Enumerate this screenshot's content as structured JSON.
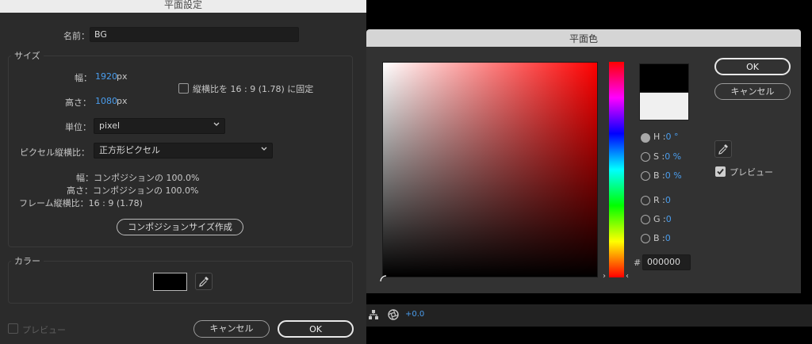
{
  "solid_settings": {
    "title": "平面設定",
    "name_label": "名前：",
    "name_value": "BG",
    "size_group_label": "サイズ",
    "width_label": "幅：",
    "width_value": "1920",
    "width_unit": "px",
    "height_label": "高さ：",
    "height_value": "1080",
    "height_unit": "px",
    "lock_aspect_label": "縦横比を 16 : 9 (1.78) に固定",
    "unit_label": "単位：",
    "unit_value": "pixel",
    "pixel_aspect_label": "ピクセル縦横比：",
    "pixel_aspect_value": "正方形ピクセル",
    "info_width": "幅：コンポジションの 100.0%",
    "info_height": "高さ：コンポジションの 100.0%",
    "info_frame": "フレーム縦横比：16 : 9 (1.78)",
    "make_comp_size_button": "コンポジションサイズ作成",
    "color_group_label": "カラー",
    "swatch_color": "#000000",
    "preview_label": "プレビュー",
    "cancel_button": "キャンセル",
    "ok_button": "OK"
  },
  "color_picker": {
    "title": "平面色",
    "ok_button": "OK",
    "cancel_button": "キャンセル",
    "new_color": "#000000",
    "old_color": "#f0f0f0",
    "h_label": "H :",
    "h_value": "0 °",
    "s_label": "S :",
    "s_value": "0 %",
    "b_label": "B :",
    "b_value": "0 %",
    "r_label": "R :",
    "r_value": "0",
    "g_label": "G :",
    "g_value": "0",
    "b2_label": "B :",
    "b2_value": "0",
    "hex_label": "#",
    "hex_value": "000000",
    "preview_label": "プレビュー"
  },
  "timeline": {
    "offset_value": "+0.0"
  }
}
